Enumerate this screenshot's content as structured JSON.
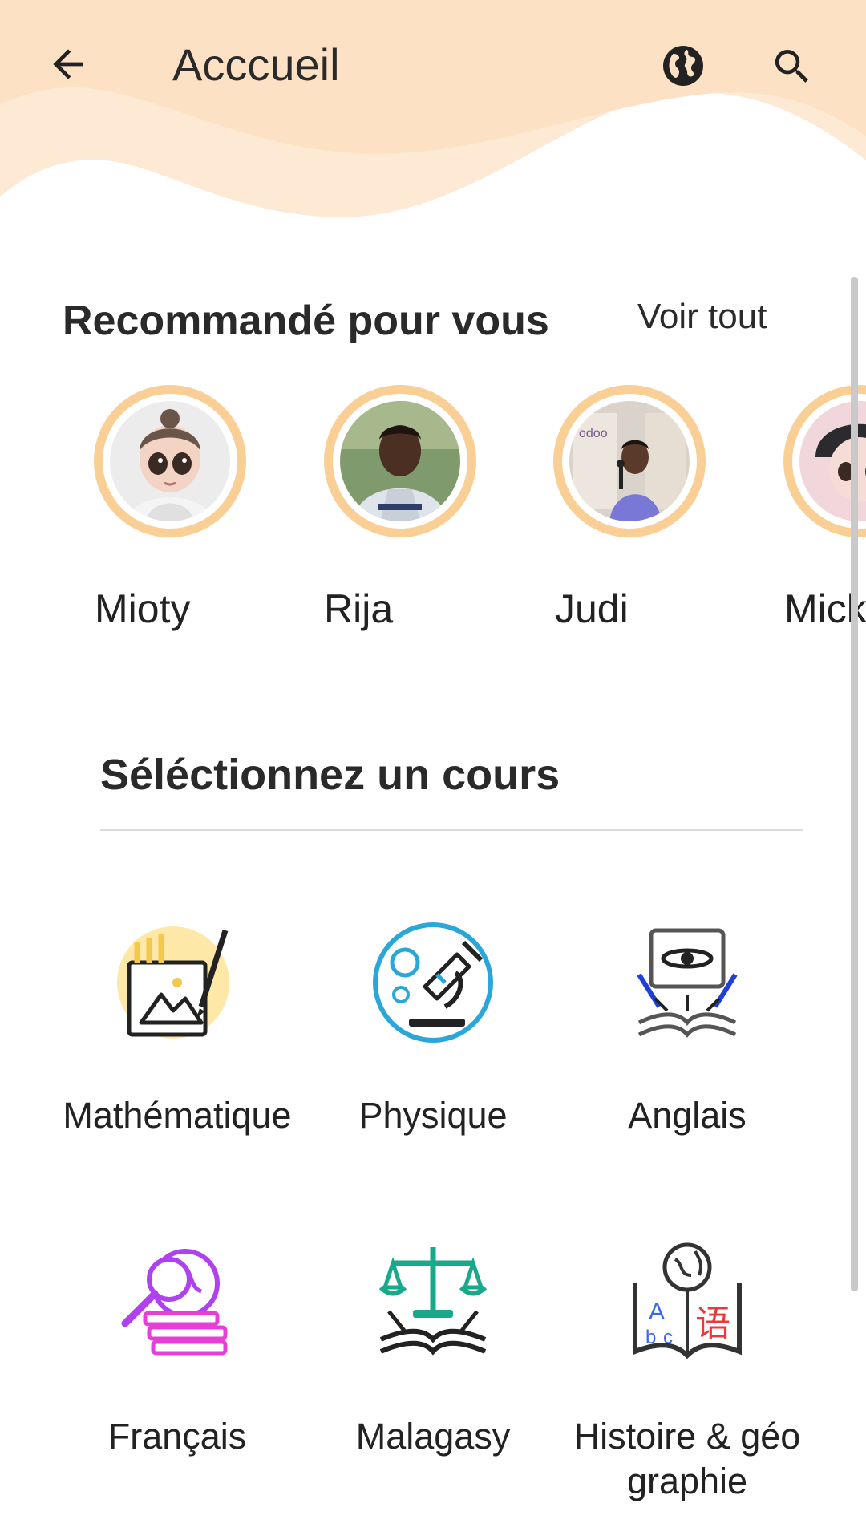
{
  "header": {
    "title": "Acccueil",
    "back_icon": "arrow-left-icon",
    "globe_icon": "globe-icon",
    "search_icon": "search-icon",
    "background_color": "#fde1c4"
  },
  "recommended": {
    "title": "Recommandé pour vous",
    "see_all": "Voir tout",
    "ring_color": "#f9cf95",
    "people": [
      {
        "name": "Mioty"
      },
      {
        "name": "Rija"
      },
      {
        "name": "Judi"
      },
      {
        "name": "Mick"
      }
    ]
  },
  "courses": {
    "title": "Séléctionnez un cours",
    "items": [
      {
        "label": "Mathématique",
        "icon": "math-art-icon"
      },
      {
        "label": "Physique",
        "icon": "microscope-icon"
      },
      {
        "label": "Anglais",
        "icon": "book-computer-icon"
      },
      {
        "label": "Français",
        "icon": "magnifier-globe-books-icon"
      },
      {
        "label": "Malagasy",
        "icon": "scales-book-icon"
      },
      {
        "label": "Histoire & géographie",
        "icon": "language-book-globe-icon"
      }
    ]
  }
}
